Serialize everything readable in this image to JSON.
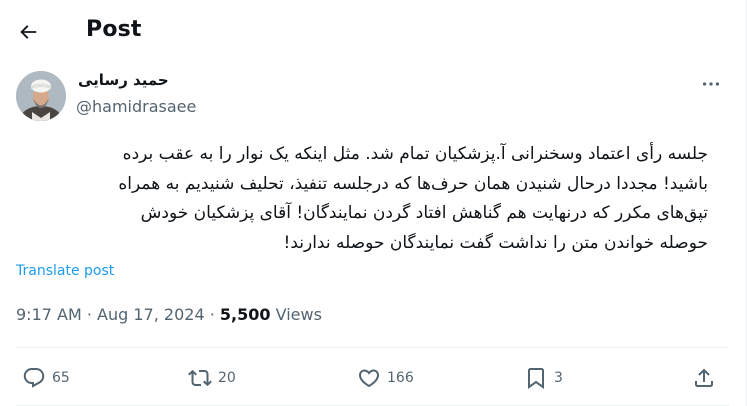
{
  "header": {
    "title": "Post"
  },
  "author": {
    "name": "حمید رسایی",
    "handle": "@hamidrasaee"
  },
  "post": {
    "lines": [
      "جلسه رأی اعتماد وسخنرانی آ.پزشکیان تمام شد. مثل اینکه یک نوار را به عقب برده",
      "باشید! مجددا درحال شنیدن همان حرف‌ها که درجلسه تنفیذ، تحلیف شنیدیم به همراه",
      "تپق‌های مکرر که درنهایت هم گناهش افتاد گردن نمایندگان! آقای پزشکیان خودش",
      "حوصله خواندن متن را نداشت گفت نمایندگان حوصله ندارند!"
    ],
    "translate_label": "Translate post",
    "time": "9:17 AM",
    "date": "Aug 17, 2024",
    "separator": "·",
    "views_count": "5,500",
    "views_label": "Views"
  },
  "actions": {
    "replies": "65",
    "reposts": "20",
    "likes": "166",
    "bookmarks": "3"
  },
  "icons": [
    "back-arrow-icon",
    "more-icon",
    "reply-icon",
    "repost-icon",
    "like-icon",
    "bookmark-icon",
    "share-icon"
  ]
}
